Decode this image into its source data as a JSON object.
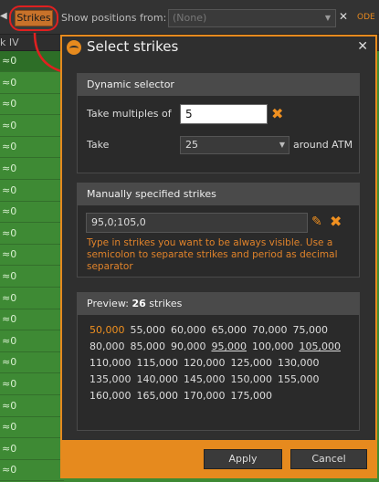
{
  "toolbar": {
    "strikes_label": "Strikes",
    "show_positions_label": "Show positions from:",
    "positions_value": "(None)",
    "odd_label": "ODE"
  },
  "grid": {
    "column_header": "k IV",
    "cell_value": "≈0",
    "rows": [
      "≈0",
      "≈0",
      "≈0",
      "≈0",
      "≈0",
      "≈0",
      "≈0",
      "≈0",
      "≈0",
      "≈0",
      "≈0",
      "≈0",
      "≈0",
      "≈0",
      "≈0",
      "≈0",
      "≈0",
      "≈0",
      "≈0",
      "≈0"
    ]
  },
  "dialog": {
    "title": "Select strikes",
    "dynamic": {
      "header": "Dynamic selector",
      "multiples_label": "Take multiples of",
      "multiples_value": "5",
      "take_label": "Take",
      "take_value": "25",
      "around_label": "around ATM"
    },
    "manual": {
      "header": "Manually specified strikes",
      "value": "95,0;105,0",
      "help": "Type in strikes you want to be always visible. Use a semicolon to separate strikes and period as decimal separator"
    },
    "preview": {
      "label": "Preview:",
      "count": "26",
      "count_suffix": "strikes",
      "rows": [
        [
          "50,000",
          "55,000",
          "60,000",
          "65,000",
          "70,000",
          "75,000"
        ],
        [
          "80,000",
          "85,000",
          "90,000",
          "95,000",
          "100,000",
          "105,000"
        ],
        [
          "110,000",
          "115,000",
          "120,000",
          "125,000",
          "130,000"
        ],
        [
          "135,000",
          "140,000",
          "145,000",
          "150,000",
          "155,000"
        ],
        [
          "160,000",
          "165,000",
          "170,000",
          "175,000"
        ]
      ],
      "highlighted": "50,000",
      "underlined": [
        "95,000",
        "105,000"
      ]
    },
    "apply_label": "Apply",
    "cancel_label": "Cancel"
  },
  "colors": {
    "accent": "#e68a1e",
    "grid_green": "#3e8a34",
    "highlight_red": "#e02020"
  }
}
